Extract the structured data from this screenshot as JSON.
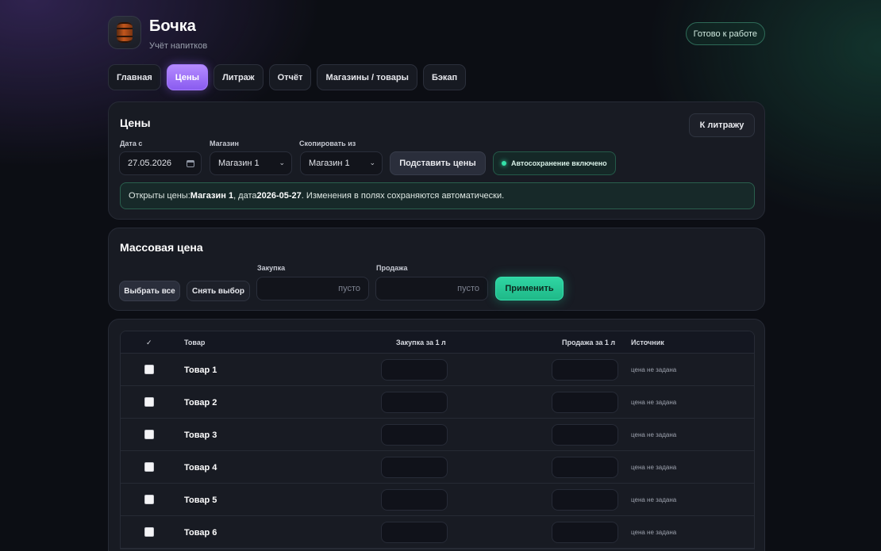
{
  "header": {
    "title": "Бочка",
    "subtitle": "Учёт напитков",
    "status": "Готово к работе"
  },
  "tabs": [
    {
      "label": "Главная",
      "active": false
    },
    {
      "label": "Цены",
      "active": true
    },
    {
      "label": "Литраж",
      "active": false
    },
    {
      "label": "Отчёт",
      "active": false
    },
    {
      "label": "Магазины / товары",
      "active": false
    },
    {
      "label": "Бэкап",
      "active": false
    }
  ],
  "prices": {
    "title": "Цены",
    "to_liters_button": "К литражу",
    "date_label": "Дата с",
    "date_value": "27.05.2026",
    "shop_label": "Магазин",
    "shop_value": "Магазин 1",
    "copy_label": "Скопировать из",
    "copy_value": "Магазин 1",
    "fill_button": "Подставить цены",
    "autosave": "Автосохранение включено",
    "notice": {
      "prefix": "Открыты цены: ",
      "shop": "Магазин 1",
      "mid": ", дата ",
      "date": "2026-05-27",
      "suffix": ". Изменения в полях сохраняются автоматически."
    }
  },
  "mass": {
    "title": "Массовая цена",
    "select_all": "Выбрать все",
    "deselect": "Снять выбор",
    "purchase_label": "Закупка",
    "purchase_placeholder": "пусто",
    "sale_label": "Продажа",
    "sale_placeholder": "пусто",
    "apply_button": "Применить"
  },
  "table": {
    "columns": {
      "check": "✓",
      "product": "Товар",
      "purchase": "Закупка за 1 л",
      "sale": "Продажа за 1 л",
      "source": "Источник"
    },
    "rows": [
      {
        "name": "Товар 1",
        "source": "цена не задана"
      },
      {
        "name": "Товар 2",
        "source": "цена не задана"
      },
      {
        "name": "Товар 3",
        "source": "цена не задана"
      },
      {
        "name": "Товар 4",
        "source": "цена не задана"
      },
      {
        "name": "Товар 5",
        "source": "цена не задана"
      },
      {
        "name": "Товар 6",
        "source": "цена не задана"
      }
    ]
  },
  "colors": {
    "accent_purple": "#9b6cff",
    "accent_green": "#2fd6a3",
    "background": "#0c0e14"
  }
}
